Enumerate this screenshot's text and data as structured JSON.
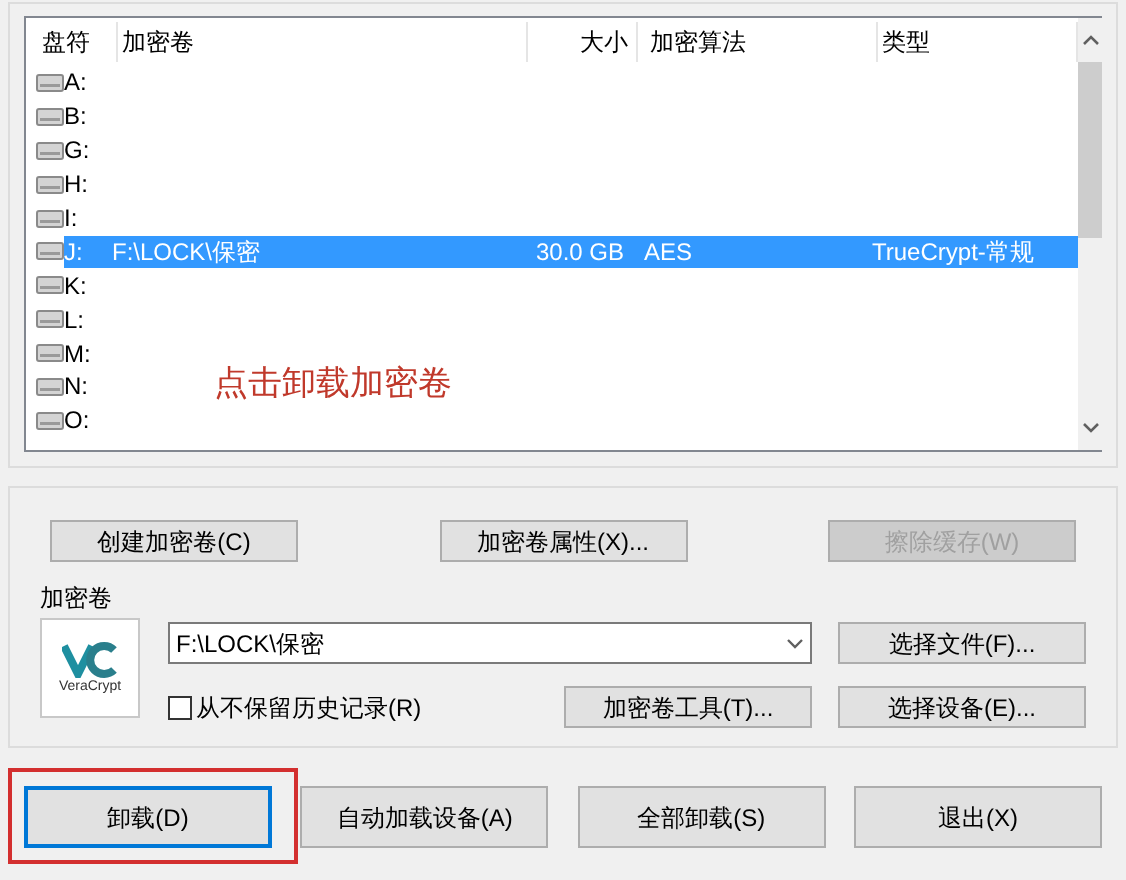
{
  "drive_list": {
    "columns": [
      "盘符",
      "加密卷",
      "大小",
      "加密算法",
      "类型"
    ],
    "rows": [
      {
        "drive": "A:",
        "selected": false
      },
      {
        "drive": "B:",
        "selected": false
      },
      {
        "drive": "G:",
        "selected": false
      },
      {
        "drive": "H:",
        "selected": false
      },
      {
        "drive": "I:",
        "selected": false
      },
      {
        "drive": "J:",
        "volume": "F:\\LOCK\\保密",
        "size": "30.0 GB",
        "algorithm": "AES",
        "type": "TrueCrypt-常规",
        "selected": true
      },
      {
        "drive": "K:",
        "selected": false
      },
      {
        "drive": "L:",
        "selected": false
      },
      {
        "drive": "M:",
        "selected": false
      },
      {
        "drive": "N:",
        "selected": false
      },
      {
        "drive": "O:",
        "selected": false
      }
    ],
    "annotation": "点击卸载加密卷"
  },
  "top_buttons": [
    {
      "label": "创建加密卷(C)",
      "disabled": false
    },
    {
      "label": "加密卷属性(X)...",
      "disabled": false
    },
    {
      "label": "擦除缓存(W)",
      "disabled": true
    }
  ],
  "volume": {
    "label": "加密卷",
    "logo_text": "VeraCrypt",
    "path": "F:\\LOCK\\保密",
    "never_save_history": {
      "label": "从不保留历史记录(R)",
      "checked": false
    },
    "tools_button": "加密卷工具(T)...",
    "select_file_button": "选择文件(F)...",
    "select_device_button": "选择设备(E)..."
  },
  "bottom_buttons": [
    {
      "label": "卸载(D)",
      "focused": true,
      "annotated": true
    },
    {
      "label": "自动加载设备(A)",
      "focused": false,
      "annotated": false
    },
    {
      "label": "全部卸载(S)",
      "focused": false,
      "annotated": false
    },
    {
      "label": "退出(X)",
      "focused": false,
      "annotated": false
    }
  ]
}
